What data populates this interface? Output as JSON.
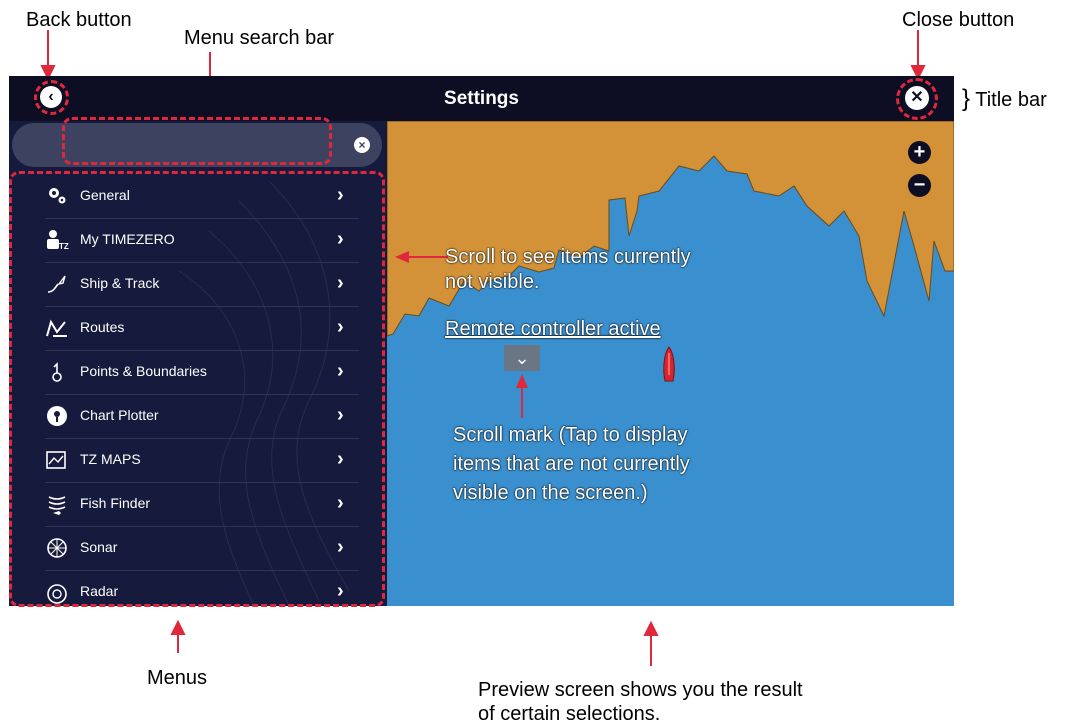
{
  "callouts": {
    "back_button": "Back button",
    "menu_search_bar": "Menu search bar",
    "close_button": "Close button",
    "title_bar": "Title bar",
    "scroll_to_see": "Scroll to see items currently",
    "scroll_to_see_2": "not visible.",
    "scroll_mark_1": "Scroll mark (Tap to display",
    "scroll_mark_2": "items that are not currently",
    "scroll_mark_3": "visible on the screen.)",
    "menus": "Menus",
    "preview_1": "Preview screen shows you the result",
    "preview_2": "of certain selections."
  },
  "titlebar": {
    "title": "Settings",
    "back_glyph": "‹",
    "close_glyph": "✕",
    "title_bar_brace": "}"
  },
  "search": {
    "value": "",
    "placeholder": "",
    "clear_glyph": "×"
  },
  "menu": {
    "chevron": "›",
    "items": [
      {
        "label": "General",
        "icon": "gears-icon"
      },
      {
        "label": "My TIMEZERO",
        "icon": "user-tz-icon"
      },
      {
        "label": "Ship & Track",
        "icon": "ship-track-icon"
      },
      {
        "label": "Routes",
        "icon": "routes-icon"
      },
      {
        "label": "Points & Boundaries",
        "icon": "points-icon"
      },
      {
        "label": "Chart Plotter",
        "icon": "chart-plotter-icon"
      },
      {
        "label": "TZ MAPS",
        "icon": "tz-maps-icon"
      },
      {
        "label": "Fish Finder",
        "icon": "fish-finder-icon"
      },
      {
        "label": "Sonar",
        "icon": "sonar-icon"
      },
      {
        "label": "Radar",
        "icon": "radar-icon"
      }
    ]
  },
  "preview": {
    "remote_controller": "Remote controller active",
    "zoom_in_glyph": "+",
    "zoom_out_glyph": "−",
    "scroll_mark_glyph": "⌄"
  },
  "colors": {
    "land": "#d39237",
    "sea": "#3a8fce",
    "titlebar": "#0d0d24",
    "menu_bg": "#161a3c",
    "highlight": "#e0283c"
  }
}
